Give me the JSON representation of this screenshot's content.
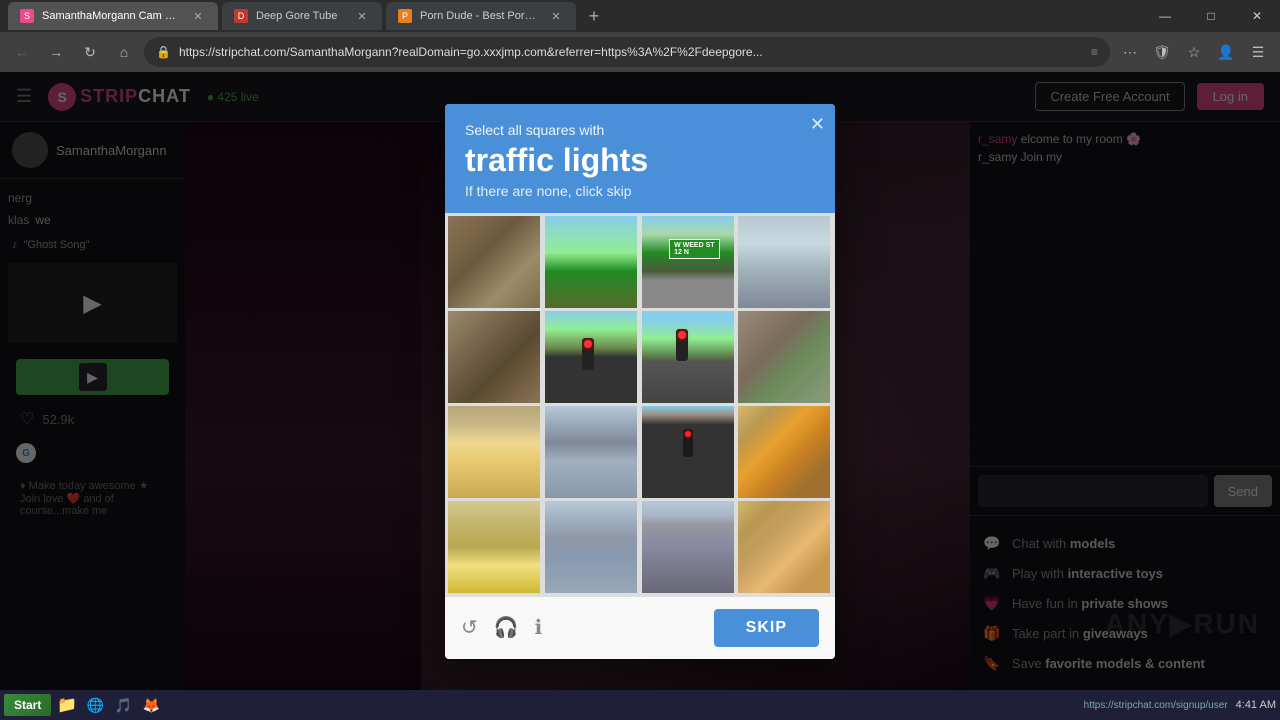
{
  "browser": {
    "tabs": [
      {
        "id": "tab1",
        "label": "SamanthaMorgann Cam Model: Fr...",
        "active": true,
        "favicon": "S"
      },
      {
        "id": "tab2",
        "label": "Deep Gore Tube",
        "active": false,
        "favicon": "D"
      },
      {
        "id": "tab3",
        "label": "Porn Dude - Best Porn Sites & Fre...",
        "active": false,
        "favicon": "P"
      }
    ],
    "address": "https://stripchat.com/SamanthaMorgann?realDomain=go.xxxjmp.com&referrer=https%3A%2F%2Fdeepgore..."
  },
  "site": {
    "name": "STRIPCHAT",
    "logo_letter": "S",
    "status": "● 425 live",
    "create_btn": "Create Free Account",
    "login_btn": "Log in"
  },
  "sidebar": {
    "username": "SamanthaMorgann",
    "chat_messages": [
      {
        "user": "nerg",
        "text": ""
      },
      {
        "user": "klas",
        "text": "we"
      }
    ],
    "ghost_song": "\"Ghost Song\"",
    "tip_btn": "",
    "like_count": "52.9k",
    "bottom_text": "♦ Make today awesome ★ Join love ❤️ and of course...make me"
  },
  "captcha": {
    "sub_label": "Select all squares with",
    "main_label": "traffic lights",
    "desc_label": "If there are none, click skip",
    "skip_btn": "SKIP",
    "footer_icons": {
      "refresh": "↺",
      "headphones": "🎧",
      "info": "ℹ"
    }
  },
  "right_panel": {
    "chat_messages": [
      {
        "user": "r_samy",
        "text": "elcome to my room 🌸"
      },
      {
        "user": "",
        "text": "r_samy  Join my"
      }
    ],
    "send_btn": "Send",
    "features": [
      {
        "icon": "💬",
        "text_before": "Chat with ",
        "text_bold": "models"
      },
      {
        "icon": "🎮",
        "text_before": "Play with ",
        "text_bold": "interactive toys"
      },
      {
        "icon": "💗",
        "text_before": "Have fun in ",
        "text_bold": "private shows"
      },
      {
        "icon": "🎁",
        "text_before": "Take part in ",
        "text_bold": "giveaways"
      },
      {
        "icon": "🔖",
        "text_before": "Save ",
        "text_bold": "favorite models & content"
      }
    ],
    "any_run": "ANY▶RUN"
  },
  "status_bar": {
    "url": "https://stripchat.com/signup/user"
  },
  "taskbar": {
    "start": "Start",
    "time": "4:41 AM"
  },
  "window_controls": {
    "minimize": "—",
    "maximize": "□",
    "close": "✕"
  }
}
